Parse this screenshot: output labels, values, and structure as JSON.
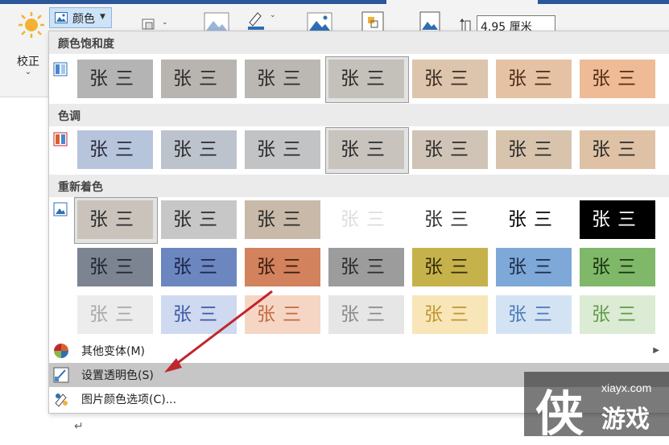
{
  "ribbon": {
    "correct_label": "校正",
    "color_label": "颜色",
    "size_value": "4.95 厘米",
    "icons": [
      "sun-icon",
      "picture-icon",
      "compress-icon",
      "picture-effect-icon",
      "fill-icon",
      "picture-add-icon",
      "selection-pane-icon",
      "crop-picture-icon",
      "height-icon"
    ]
  },
  "menu": {
    "sections": [
      {
        "title": "颜色饱和度",
        "thumbs": [
          {
            "bg": "#b4b4b4",
            "ink": "#2a2a2a"
          },
          {
            "bg": "#b8b5b1",
            "ink": "#2a2a2a"
          },
          {
            "bg": "#bbb8b3",
            "ink": "#2a2a2a"
          },
          {
            "bg": "#c4c0ba",
            "ink": "#2a2a2a"
          },
          {
            "bg": "#dcc4ad",
            "ink": "#3a2a20"
          },
          {
            "bg": "#e6c2a4",
            "ink": "#4a2a18"
          },
          {
            "bg": "#eebb96",
            "ink": "#552a12"
          }
        ]
      },
      {
        "title": "色调",
        "thumbs": [
          {
            "bg": "#b7c5dc",
            "ink": "#2a2a3a"
          },
          {
            "bg": "#bcc3cc",
            "ink": "#2a2a2a"
          },
          {
            "bg": "#c2c3c4",
            "ink": "#2a2a2a"
          },
          {
            "bg": "#c8c3bd",
            "ink": "#2a2a2a"
          },
          {
            "bg": "#cfc4b5",
            "ink": "#2a2a2a"
          },
          {
            "bg": "#d8c4ad",
            "ink": "#2a2a2a"
          },
          {
            "bg": "#dfc2a5",
            "ink": "#2a2a2a"
          }
        ]
      },
      {
        "title": "重新着色",
        "thumbs": [
          {
            "bg": "#c9c3bb",
            "ink": "#2a2a2a"
          },
          {
            "bg": "#c7c7c7",
            "ink": "#2a2a2a"
          },
          {
            "bg": "#c8b9a8",
            "ink": "#2a2a2a"
          },
          {
            "bg": "#ffffff",
            "ink": "#dddddd"
          },
          {
            "bg": "#ffffff",
            "ink": "#333333"
          },
          {
            "bg": "#ffffff",
            "ink": "#000000"
          },
          {
            "bg": "#000000",
            "ink": "#ffffff"
          },
          {
            "bg": "#7c8391",
            "ink": "#1f2430"
          },
          {
            "bg": "#6c86c0",
            "ink": "#1a2448"
          },
          {
            "bg": "#d2825c",
            "ink": "#3a1a10"
          },
          {
            "bg": "#9c9c9c",
            "ink": "#2a2a2a"
          },
          {
            "bg": "#c6b24a",
            "ink": "#302a08"
          },
          {
            "bg": "#7ea8d8",
            "ink": "#1a2a48"
          },
          {
            "bg": "#7fb868",
            "ink": "#1a3010"
          },
          {
            "bg": "#ececec",
            "ink": "#a8a8a8"
          },
          {
            "bg": "#cfd9ef",
            "ink": "#3c5aa6"
          },
          {
            "bg": "#f5d6c4",
            "ink": "#c46a40"
          },
          {
            "bg": "#e6e6e6",
            "ink": "#8a8a8a"
          },
          {
            "bg": "#f8e6b8",
            "ink": "#c09530"
          },
          {
            "bg": "#d4e3f4",
            "ink": "#4a78b8"
          },
          {
            "bg": "#dcebd4",
            "ink": "#5e9a48"
          }
        ]
      }
    ],
    "signature_text": "张三",
    "items": [
      {
        "label": "其他变体(M)",
        "icon": "color-wheel-icon",
        "has_submenu": true
      },
      {
        "label": "设置透明色(S)",
        "icon": "transparent-color-icon",
        "highlighted": true
      },
      {
        "label": "图片颜色选项(C)...",
        "icon": "picture-color-options-icon"
      }
    ]
  },
  "watermark": {
    "site": "xiayx.com",
    "brand": "游戏",
    "logo_char": "侠"
  },
  "colors": {
    "accent_red": "#c0272d",
    "highlight": "#c6c6c6",
    "section_bg": "#ebebeb"
  }
}
